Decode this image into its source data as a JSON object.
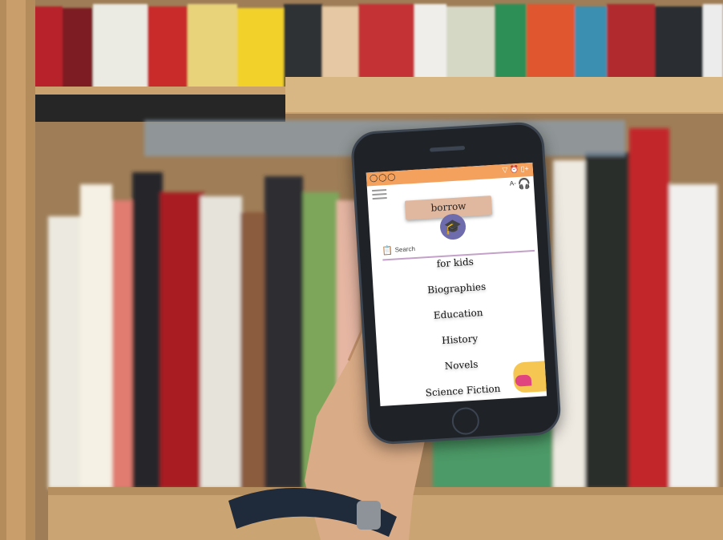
{
  "statusbar": {
    "left_icons": "◯◯◯",
    "right_icons": "▽ ⏰ ▯+"
  },
  "header": {
    "font_size_label": "A-",
    "menu_icon": "menu-icon",
    "headset_icon": "headset-icon"
  },
  "borrow": {
    "label": "borrow",
    "badge_icon": "graduation-cap-icon",
    "badge_glyph": "🎓"
  },
  "search": {
    "label": "Search",
    "icon_glyph": "📋"
  },
  "categories": [
    "for kids",
    "Biographies",
    "Education",
    "History",
    "Novels",
    "Science Fiction"
  ],
  "colors": {
    "statusbar": "#f4a15d",
    "borrow_button": "#e0b8a0",
    "badge": "#6f6cae",
    "accent_yellow": "#f6c653",
    "accent_pink": "#e0457f"
  }
}
